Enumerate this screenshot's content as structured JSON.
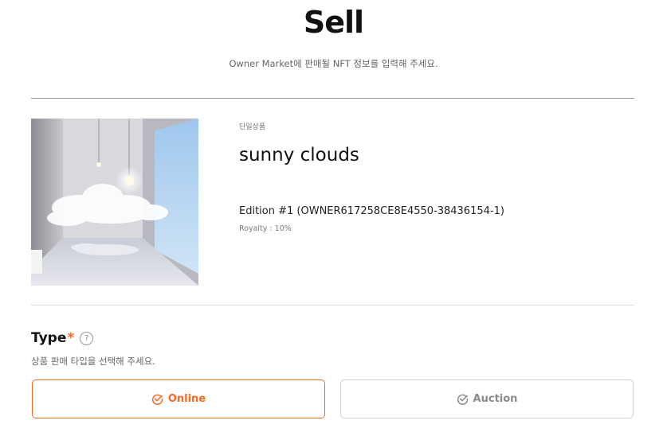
{
  "header": {
    "title": "Sell",
    "subtitle": "Owner Market에 판매될 NFT 정보를 입력해 주세요."
  },
  "item": {
    "tag": "단일상품",
    "name": "sunny clouds",
    "edition": "Edition #1 (OWNER617258CE8E4550-38436154-1)",
    "royalty": "Royalty : 10%"
  },
  "type_section": {
    "label": "Type",
    "required_mark": "*",
    "help_icon": "question-circle-icon",
    "help_glyph": "?",
    "description": "상품 판매 타입을 선택해 주세요.",
    "options": [
      {
        "label": "Online",
        "icon": "check-circle-icon",
        "selected": true
      },
      {
        "label": "Auction",
        "icon": "check-circle-icon",
        "selected": false
      }
    ]
  },
  "colors": {
    "accent": "#f26b24",
    "inactive": "#8a8a8a"
  }
}
